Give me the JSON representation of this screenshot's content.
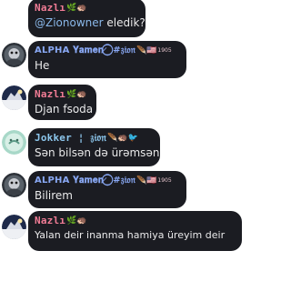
{
  "colors": {
    "nazli_name": "#f07c95",
    "alpha_name": "#89a8f4",
    "jokker_name": "#8cc6ec",
    "bubble_bg": "#1b1c22",
    "text": "#e9e9ea",
    "mention": "#8ab8ea"
  },
  "messages": [
    {
      "sender": "Nazlı",
      "sender_emoji": "🌿🦔",
      "mention": "@Zionowner",
      "text": " eledik?"
    },
    {
      "sender": "ALPHA 𝐘𝐚𝐦𝐞𝐧 ̷ ⃝ #𝔷𝔦𝔬𝔫",
      "sender_emoji": "🪶🇺🇸",
      "sender_sup": "1905",
      "text": "He"
    },
    {
      "sender": "Nazlı",
      "sender_emoji": "🌿🦔",
      "text": "Djan fsoda"
    },
    {
      "sender": "Jokker ¦ 𝔷𝔦𝔬𝔫",
      "sender_emoji": "🪶🦔🐦",
      "text": "Sən bilsən də ürəmsən"
    },
    {
      "sender": "ALPHA 𝐘𝐚𝐦𝐞𝐧 ̷ ⃝ #𝔷𝔦𝔬𝔫",
      "sender_emoji": "🪶🇺🇸",
      "sender_sup": "1905",
      "text": "Bilirem"
    },
    {
      "sender": "Nazlı",
      "sender_emoji": "🌿🦔",
      "text": "Yalan deir inanma hamiya üreyim deir"
    }
  ]
}
